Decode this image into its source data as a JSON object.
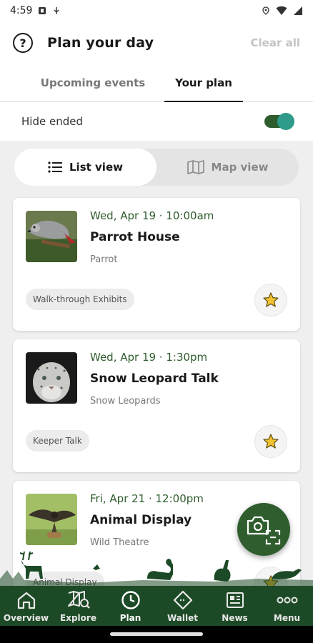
{
  "status_bar": {
    "time": "4:59"
  },
  "header": {
    "title": "Plan your day",
    "clear_all": "Clear all"
  },
  "tabs": [
    {
      "label": "Upcoming events",
      "active": false
    },
    {
      "label": "Your plan",
      "active": true
    }
  ],
  "filter": {
    "hide_ended_label": "Hide ended",
    "hide_ended_on": true
  },
  "view_switch": {
    "list_label": "List view",
    "map_label": "Map view",
    "selected": "list"
  },
  "events": [
    {
      "time": "Wed, Apr 19 · 10:00am",
      "title": "Parrot House",
      "location": "Parrot",
      "tag": "Walk-through Exhibits",
      "thumb": "parrot-photo"
    },
    {
      "time": "Wed, Apr 19 · 1:30pm",
      "title": "Snow Leopard Talk",
      "location": "Snow Leopards",
      "tag": "Keeper Talk",
      "thumb": "snow-leopard-photo"
    },
    {
      "time": "Fri, Apr 21 · 12:00pm",
      "title": "Animal Display",
      "location": "Wild Theatre",
      "tag": "Animal Display",
      "thumb": "bird-of-prey-photo"
    }
  ],
  "bottom_nav": [
    {
      "label": "Overview",
      "icon": "home-icon"
    },
    {
      "label": "Explore",
      "icon": "map-search-icon"
    },
    {
      "label": "Plan",
      "icon": "clock-icon",
      "active": true
    },
    {
      "label": "Wallet",
      "icon": "ticket-icon"
    },
    {
      "label": "News",
      "icon": "newspaper-icon"
    },
    {
      "label": "Menu",
      "icon": "dots-icon"
    }
  ],
  "colors": {
    "brand_green": "#2f5d2e",
    "nav_green": "#1d4a26",
    "toggle_knob": "#2e9a8a",
    "star_yellow": "#f2c230"
  }
}
